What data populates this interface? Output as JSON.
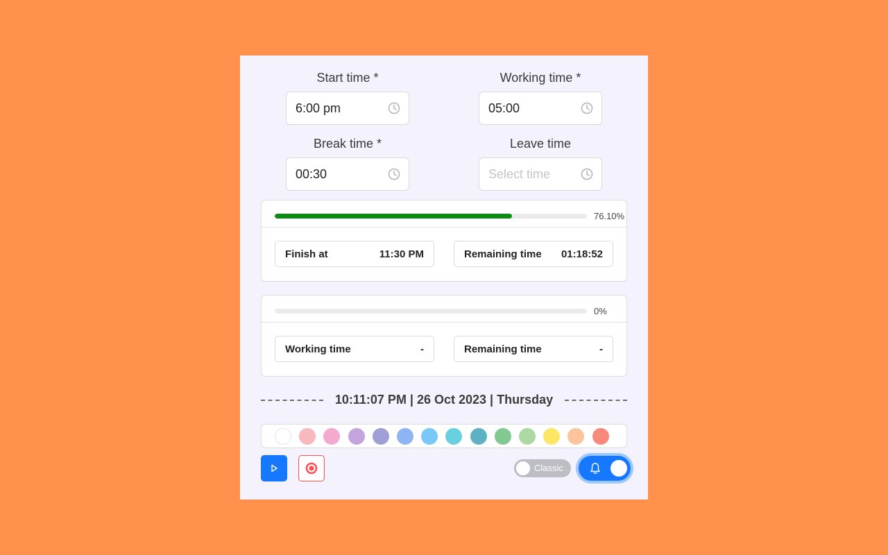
{
  "fields": {
    "start": {
      "label": "Start time *",
      "value": "6:00 pm"
    },
    "working": {
      "label": "Working time *",
      "value": "05:00"
    },
    "break": {
      "label": "Break time *",
      "value": "00:30"
    },
    "leave": {
      "label": "Leave time",
      "placeholder": "Select time",
      "value": ""
    }
  },
  "work_card": {
    "progress_value": 76.1,
    "progress_label": "76.10%",
    "progress_color": "#0d8a12",
    "finish_label": "Finish at",
    "finish_value": "11:30 PM",
    "remaining_label": "Remaining time",
    "remaining_value": "01:18:52"
  },
  "leave_card": {
    "progress_value": 0,
    "progress_label": "0%",
    "working_label": "Working time",
    "working_value": "-",
    "remaining_label": "Remaining time",
    "remaining_value": "-"
  },
  "datetime": "10:11:07 PM | 26 Oct 2023 | Thursday",
  "theme_colors": [
    "#ffffff",
    "#f7b9bd",
    "#f4a9cf",
    "#c4a4dc",
    "#9f9fd6",
    "#8fb4f2",
    "#79c8f7",
    "#68d0de",
    "#5eb1c2",
    "#82c991",
    "#aed8a3",
    "#fbe765",
    "#fcc49c",
    "#f98a7b"
  ],
  "controls": {
    "play_icon": "play-icon",
    "stop_icon": "record-stop-icon",
    "classic_label": "Classic",
    "classic_on": false,
    "bell_on": true,
    "accent": "#1677ff",
    "danger": "#ff4d4f"
  }
}
